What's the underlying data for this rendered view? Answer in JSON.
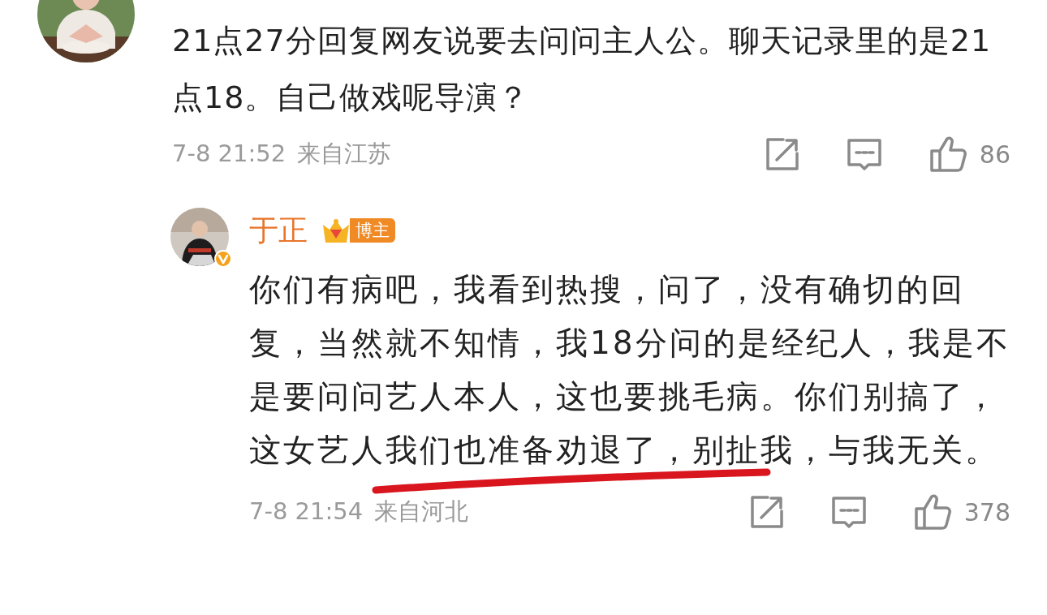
{
  "comments": [
    {
      "text": "21点27分回复网友说要去问问主人公。聊天记录里的是21点18。自己做戏呢导演？",
      "time": "7-8 21:52",
      "location": "来自江苏",
      "likes": "86",
      "replies": [
        {
          "author": "于正",
          "badge": "博主",
          "verified": true,
          "text": "你们有病吧，我看到热搜，问了，没有确切的回复，当然就不知情，我18分问的是经纪人，我是不是要问问艺人本人，这也要挑毛病。你们别搞了，这女艺人我们也准备劝退了，别扯我，与我无关。",
          "time": "7-8 21:54",
          "location": "来自河北",
          "likes": "378"
        }
      ]
    }
  ]
}
